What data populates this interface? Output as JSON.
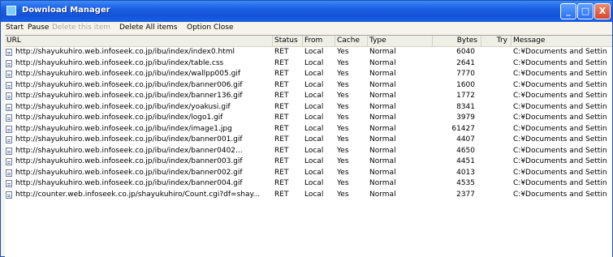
{
  "window": {
    "title": "Download Manager",
    "buttons": {
      "minimize": "_",
      "maximize": "□",
      "close": "X"
    }
  },
  "menu": [
    {
      "label": "Start",
      "enabled": true
    },
    {
      "label": "Pause",
      "enabled": true
    },
    {
      "label": "Delete this item",
      "enabled": false
    },
    {
      "label": "Delete All items",
      "enabled": true
    },
    {
      "label": "Option",
      "enabled": true
    },
    {
      "label": "Close",
      "enabled": true
    }
  ],
  "table": {
    "columns": [
      "URL",
      "Status",
      "From",
      "Cache",
      "Type",
      "Bytes",
      "Try",
      "Message"
    ],
    "rows": [
      {
        "url": "http://shayukuhiro.web.infoseek.co.jp/ibu/index/index0.html",
        "status": "RET",
        "from": "Local",
        "cache": "Yes",
        "type": "Normal",
        "bytes": "6040",
        "try": "",
        "message": "C:¥Documents and Settin"
      },
      {
        "url": "http://shayukuhiro.web.infoseek.co.jp/ibu/index/table.css",
        "status": "RET",
        "from": "Local",
        "cache": "Yes",
        "type": "Normal",
        "bytes": "2641",
        "try": "",
        "message": "C:¥Documents and Settin"
      },
      {
        "url": "http://shayukuhiro.web.infoseek.co.jp/ibu/index/wallpp005.gif",
        "status": "RET",
        "from": "Local",
        "cache": "Yes",
        "type": "Normal",
        "bytes": "7770",
        "try": "",
        "message": "C:¥Documents and Settin"
      },
      {
        "url": "http://shayukuhiro.web.infoseek.co.jp/ibu/index/banner006.gif",
        "status": "RET",
        "from": "Local",
        "cache": "Yes",
        "type": "Normal",
        "bytes": "1600",
        "try": "",
        "message": "C:¥Documents and Settin"
      },
      {
        "url": "http://shayukuhiro.web.infoseek.co.jp/ibu/index/banner136.gif",
        "status": "RET",
        "from": "Local",
        "cache": "Yes",
        "type": "Normal",
        "bytes": "1772",
        "try": "",
        "message": "C:¥Documents and Settin"
      },
      {
        "url": "http://shayukuhiro.web.infoseek.co.jp/ibu/index/yoakusi.gif",
        "status": "RET",
        "from": "Local",
        "cache": "Yes",
        "type": "Normal",
        "bytes": "8341",
        "try": "",
        "message": "C:¥Documents and Settin"
      },
      {
        "url": "http://shayukuhiro.web.infoseek.co.jp/ibu/index/logo1.gif",
        "status": "RET",
        "from": "Local",
        "cache": "Yes",
        "type": "Normal",
        "bytes": "3979",
        "try": "",
        "message": "C:¥Documents and Settin"
      },
      {
        "url": "http://shayukuhiro.web.infoseek.co.jp/ibu/index/image1.jpg",
        "status": "RET",
        "from": "Local",
        "cache": "Yes",
        "type": "Normal",
        "bytes": "61427",
        "try": "",
        "message": "C:¥Documents and Settin"
      },
      {
        "url": "http://shayukuhiro.web.infoseek.co.jp/ibu/index/banner001.gif",
        "status": "RET",
        "from": "Local",
        "cache": "Yes",
        "type": "Normal",
        "bytes": "4407",
        "try": "",
        "message": "C:¥Documents and Settin"
      },
      {
        "url": "http://shayukuhiro.web.infoseek.co.jp/ibu/index/banner0402...",
        "status": "RET",
        "from": "Local",
        "cache": "Yes",
        "type": "Normal",
        "bytes": "4650",
        "try": "",
        "message": "C:¥Documents and Settin"
      },
      {
        "url": "http://shayukuhiro.web.infoseek.co.jp/ibu/index/banner003.gif",
        "status": "RET",
        "from": "Local",
        "cache": "Yes",
        "type": "Normal",
        "bytes": "4451",
        "try": "",
        "message": "C:¥Documents and Settin"
      },
      {
        "url": "http://shayukuhiro.web.infoseek.co.jp/ibu/index/banner002.gif",
        "status": "RET",
        "from": "Local",
        "cache": "Yes",
        "type": "Normal",
        "bytes": "4013",
        "try": "",
        "message": "C:¥Documents and Settin"
      },
      {
        "url": "http://shayukuhiro.web.infoseek.co.jp/ibu/index/banner004.gif",
        "status": "RET",
        "from": "Local",
        "cache": "Yes",
        "type": "Normal",
        "bytes": "4535",
        "try": "",
        "message": "C:¥Documents and Settin"
      },
      {
        "url": "http://counter.web.infoseek.co.jp/shayukuhiro/Count.cgi?df=shay...",
        "status": "RET",
        "from": "Local",
        "cache": "Yes",
        "type": "Normal",
        "bytes": "2377",
        "try": "",
        "message": "C:¥Documents and Settin"
      }
    ]
  }
}
